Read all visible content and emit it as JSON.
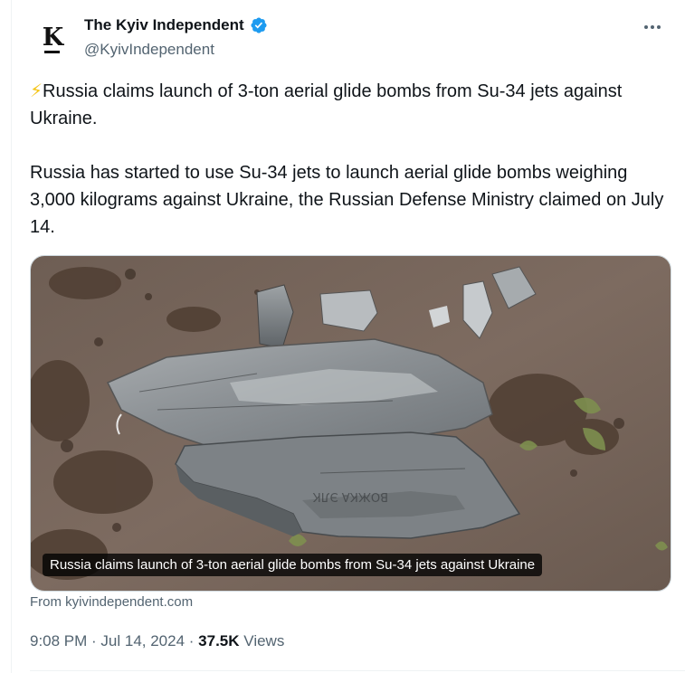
{
  "author": {
    "name": "The Kyiv Independent",
    "handle": "@KyivIndependent",
    "avatar_letter": "K",
    "verified": true
  },
  "icons": {
    "verified": "verified-badge-icon",
    "more": "more-options-icon",
    "lightning": "high-voltage-emoji"
  },
  "tweet": {
    "emoji": "⚡",
    "headline": "Russia claims launch of 3-ton aerial glide bombs from Su-34 jets against Ukraine.",
    "body": "Russia has started to use Su-34 jets to launch aerial glide bombs weighing 3,000 kilograms against Ukraine, the Russian Defense Ministry claimed on July 14."
  },
  "link_card": {
    "caption": "Russia claims launch of 3-ton aerial glide bombs from Su-34 jets against Ukraine",
    "source": "From kyivindependent.com"
  },
  "meta": {
    "time": "9:08 PM",
    "separator": " · ",
    "date": "Jul 14, 2024",
    "views_count": "37.5K",
    "views_label": "Views"
  },
  "colors": {
    "verified": "#1d9bf0",
    "secondary_text": "#536471",
    "primary_text": "#0f1419"
  }
}
